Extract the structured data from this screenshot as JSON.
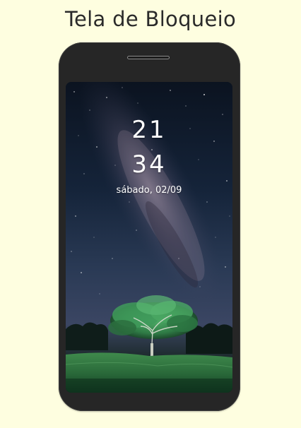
{
  "page": {
    "title": "Tela de Bloqueio"
  },
  "lock_screen": {
    "hours": "21",
    "minutes": "34",
    "date": "sábado, 02/09",
    "wallpaper": "night-sky-milky-way-tree"
  },
  "colors": {
    "background": "#fefee0",
    "phone_body": "#262626",
    "clock_text": "#ffffff"
  }
}
